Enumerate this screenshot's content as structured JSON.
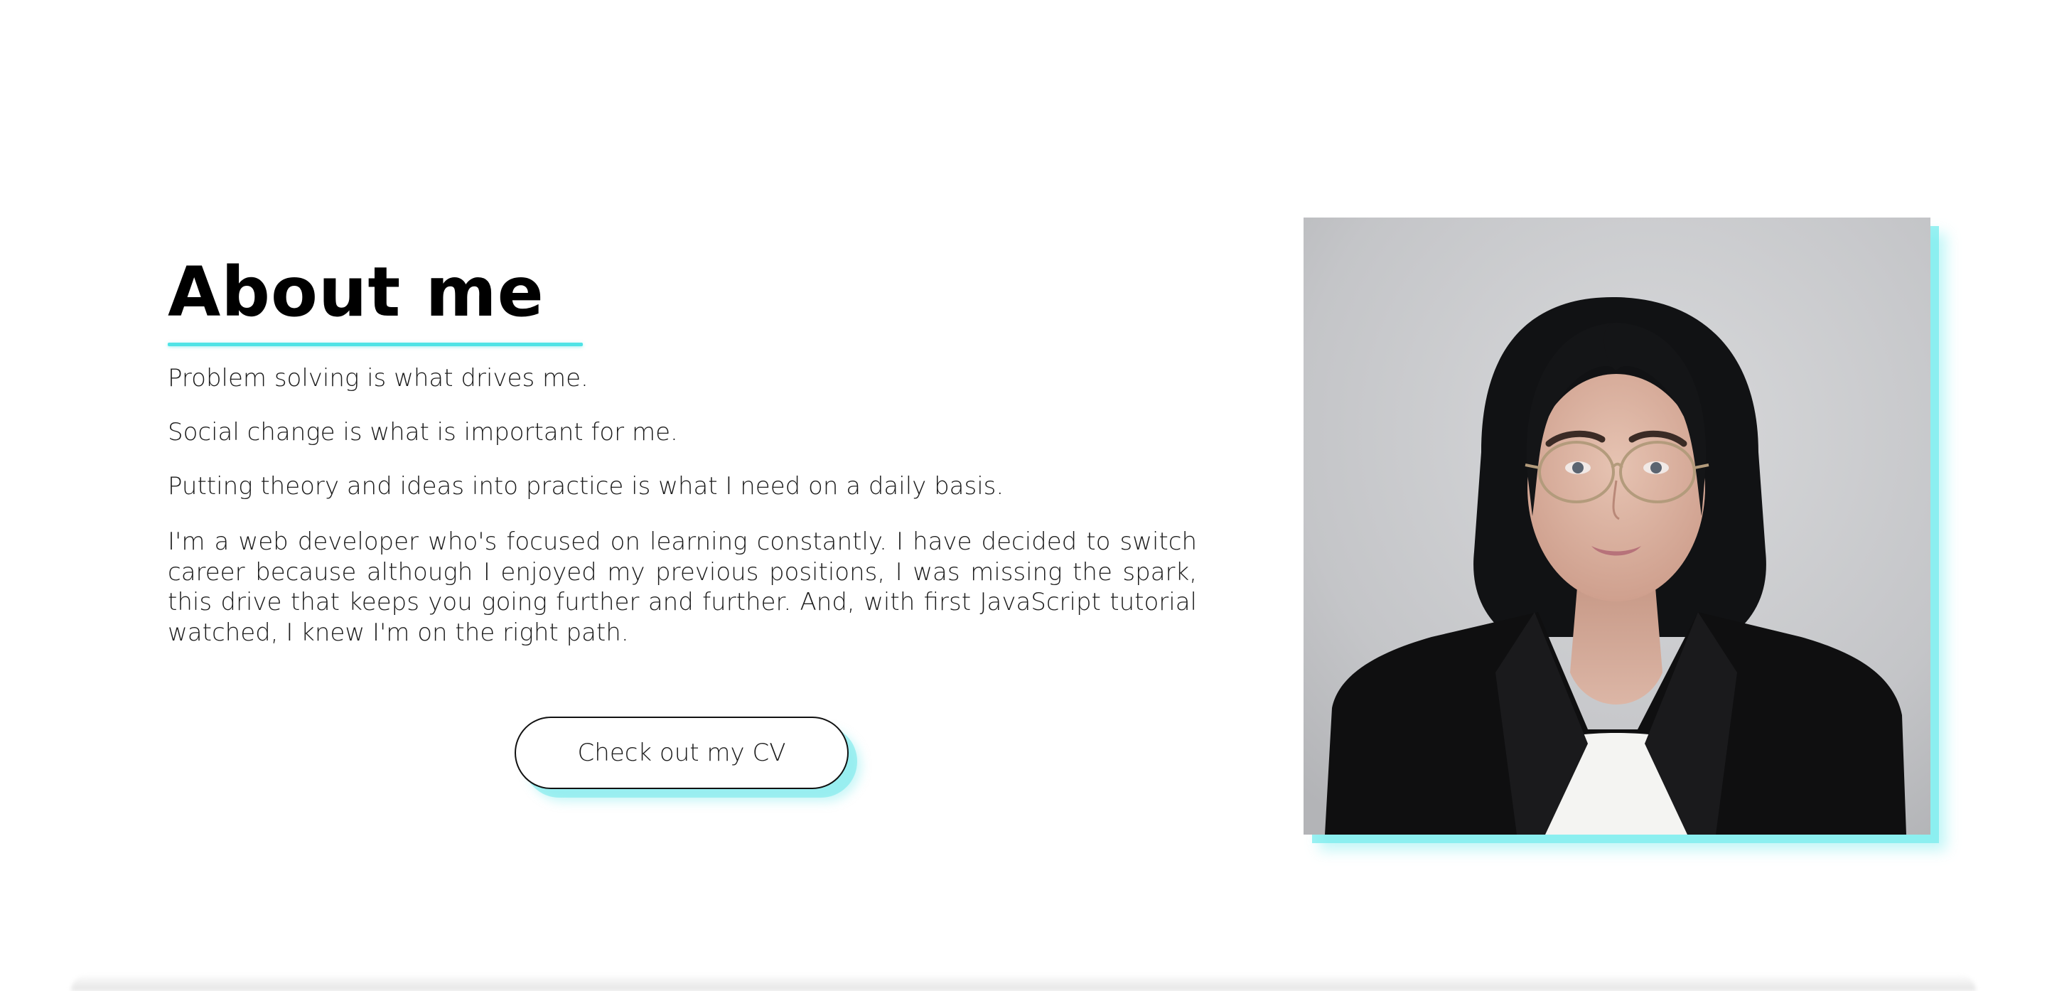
{
  "about": {
    "heading": "About me",
    "paragraphs": [
      "Problem solving is what drives me.",
      "Social change is what is important for me.",
      "Putting theory and ideas into practice is what I need on a daily basis."
    ],
    "bio": "I'm a web developer who's focused on learning constantly. I have decided to switch career because although I enjoyed my previous positions, I was missing the spark, this drive that keeps you going further and further. And, with first JavaScript tutorial watched, I knew I'm on the right path.",
    "cv_button_label": "Check out my CV"
  },
  "colors": {
    "accent": "#4fe3e6",
    "text": "#1c1c1c",
    "background": "#ffffff"
  },
  "photo": {
    "alt": "Portrait photo"
  }
}
